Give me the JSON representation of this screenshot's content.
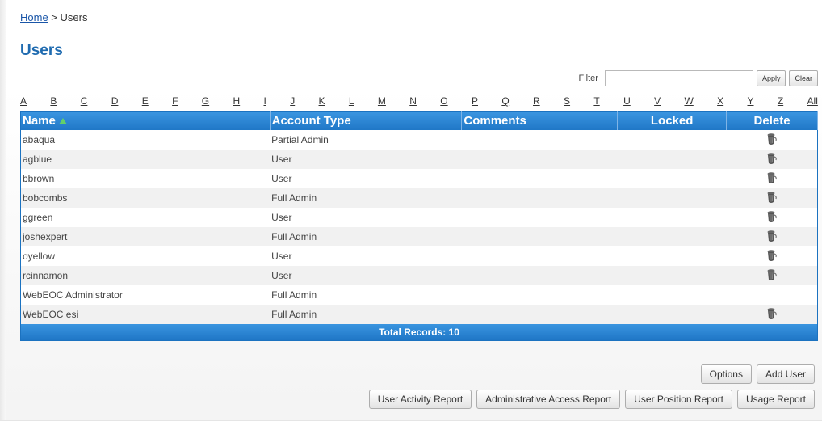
{
  "breadcrumb": {
    "home": "Home",
    "separator": " > ",
    "current": "Users"
  },
  "page_title": "Users",
  "filter": {
    "label": "Filter",
    "value": "",
    "placeholder": "",
    "apply_label": "Apply",
    "clear_label": "Clear"
  },
  "alphabet": [
    "A",
    "B",
    "C",
    "D",
    "E",
    "F",
    "G",
    "H",
    "I",
    "J",
    "K",
    "L",
    "M",
    "N",
    "O",
    "P",
    "Q",
    "R",
    "S",
    "T",
    "U",
    "V",
    "W",
    "X",
    "Y",
    "Z",
    "All"
  ],
  "table": {
    "headers": {
      "name": "Name",
      "account_type": "Account Type",
      "comments": "Comments",
      "locked": "Locked",
      "delete": "Delete"
    },
    "rows": [
      {
        "name": "abaqua",
        "account_type": "Partial Admin",
        "comments": "",
        "locked": "",
        "deletable": true
      },
      {
        "name": "agblue",
        "account_type": "User",
        "comments": "",
        "locked": "",
        "deletable": true
      },
      {
        "name": "bbrown",
        "account_type": "User",
        "comments": "",
        "locked": "",
        "deletable": true
      },
      {
        "name": "bobcombs",
        "account_type": "Full Admin",
        "comments": "",
        "locked": "",
        "deletable": true
      },
      {
        "name": "ggreen",
        "account_type": "User",
        "comments": "",
        "locked": "",
        "deletable": true
      },
      {
        "name": "joshexpert",
        "account_type": "Full Admin",
        "comments": "",
        "locked": "",
        "deletable": true
      },
      {
        "name": "oyellow",
        "account_type": "User",
        "comments": "",
        "locked": "",
        "deletable": true
      },
      {
        "name": "rcinnamon",
        "account_type": "User",
        "comments": "",
        "locked": "",
        "deletable": true
      },
      {
        "name": "WebEOC Administrator",
        "account_type": "Full Admin",
        "comments": "",
        "locked": "",
        "deletable": false
      },
      {
        "name": "WebEOC esi",
        "account_type": "Full Admin",
        "comments": "",
        "locked": "",
        "deletable": true
      }
    ],
    "footer": "Total Records: 10"
  },
  "buttons": {
    "options": "Options",
    "add_user": "Add User",
    "user_activity_report": "User Activity Report",
    "administrative_access_report": "Administrative Access Report",
    "user_position_report": "User Position Report",
    "usage_report": "Usage Report"
  },
  "icons": {
    "sort": "sort-ascending-icon",
    "delete": "trash-icon"
  },
  "colors": {
    "header_blue": "#1f76c6",
    "title_blue": "#1f6bb0",
    "link_blue": "#1a56a8"
  }
}
